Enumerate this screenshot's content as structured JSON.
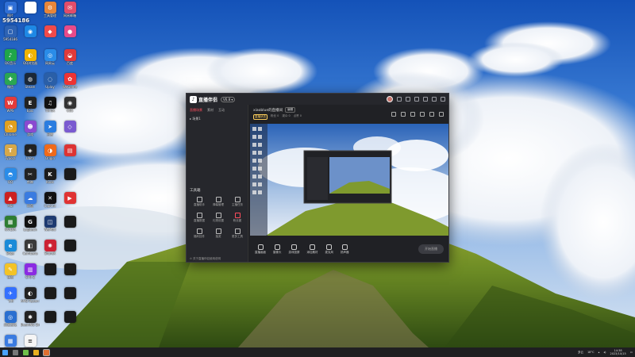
{
  "desktop": {
    "id_label": "5954186",
    "icons": [
      {
        "label": "图片",
        "color": "#2f6fd6",
        "glyph": "▣"
      },
      {
        "label": "",
        "color": "#ffffff",
        "glyph": ""
      },
      {
        "label": "工具管理",
        "color": "#e8863a",
        "glyph": "⚙"
      },
      {
        "label": "网易邮箱",
        "color": "#e14d6a",
        "glyph": "✉"
      },
      {
        "label": "5954186",
        "color": "#2d62b3",
        "glyph": "▢"
      },
      {
        "label": "",
        "color": "#1e88e5",
        "glyph": "◉"
      },
      {
        "label": "",
        "color": "#f04a4a",
        "glyph": "◆"
      },
      {
        "label": "",
        "color": "#e84b8a",
        "glyph": "●"
      },
      {
        "label": "QQ音乐",
        "color": "#1fa64a",
        "glyph": "♪"
      },
      {
        "label": "QQ浏览器",
        "color": "#f0b400",
        "glyph": "◐"
      },
      {
        "label": "网易云",
        "color": "#2a8ce8",
        "glyph": "◎"
      },
      {
        "label": "百度",
        "color": "#e03a3a",
        "glyph": "◒"
      },
      {
        "label": "微信",
        "color": "#2aa652",
        "glyph": "✚"
      },
      {
        "label": "Steam",
        "color": "#1b2838",
        "glyph": "◍"
      },
      {
        "label": "Uplay",
        "color": "#2a5fa8",
        "glyph": "◌"
      },
      {
        "label": "WeGame",
        "color": "#e33",
        "glyph": "✿"
      },
      {
        "label": "WPS",
        "color": "#e33b3b",
        "glyph": "W"
      },
      {
        "label": "Epic",
        "color": "#222",
        "glyph": "E"
      },
      {
        "label": "TikTok",
        "color": "#111",
        "glyph": "♫"
      },
      {
        "label": "OBS",
        "color": "#333",
        "glyph": "◉"
      },
      {
        "label": "Chrome",
        "color": "#e0a020",
        "glyph": "◔"
      },
      {
        "label": "游戏",
        "color": "#8a4ad0",
        "glyph": "☻"
      },
      {
        "label": "迅雷",
        "color": "#2b7de0",
        "glyph": "➤"
      },
      {
        "label": "",
        "color": "#7a5ad0",
        "glyph": "◇"
      },
      {
        "label": "Typora",
        "color": "#d7a84a",
        "glyph": "T"
      },
      {
        "label": "Unity",
        "color": "#222",
        "glyph": "◈"
      },
      {
        "label": "Origin",
        "color": "#f06a1a",
        "glyph": "◑"
      },
      {
        "label": "",
        "color": "#dd3333",
        "glyph": "▤"
      },
      {
        "label": "QQ",
        "color": "#2a8ce8",
        "glyph": "◓"
      },
      {
        "label": "剪映",
        "color": "#222",
        "glyph": "✂"
      },
      {
        "label": "Kook",
        "color": "#1c1c1c",
        "glyph": "K"
      },
      {
        "label": "",
        "color": "#1a1a1a",
        "glyph": ""
      },
      {
        "label": "MSI",
        "color": "#cc2020",
        "glyph": "▲"
      },
      {
        "label": "网盘",
        "color": "#3a7be0",
        "glyph": "☁"
      },
      {
        "label": "CapCut",
        "color": "#111",
        "glyph": "✕"
      },
      {
        "label": "",
        "color": "#e03232",
        "glyph": "▶"
      },
      {
        "label": "NVIDIA",
        "color": "#2e7d32",
        "glyph": "▦"
      },
      {
        "label": "Logitech",
        "color": "#111",
        "glyph": "G"
      },
      {
        "label": "WeMod",
        "color": "#1d3a70",
        "glyph": "◫"
      },
      {
        "label": "",
        "color": "#1a1a1a",
        "glyph": ""
      },
      {
        "label": "Edge",
        "color": "#1a8bd8",
        "glyph": "e"
      },
      {
        "label": "Camtasia",
        "color": "#3a3a3a",
        "glyph": "◧"
      },
      {
        "label": "ShareX",
        "color": "#c23",
        "glyph": "✺"
      },
      {
        "label": "",
        "color": "#1a1a1a",
        "glyph": ""
      },
      {
        "label": "便签",
        "color": "#f3c326",
        "glyph": "✎"
      },
      {
        "label": "CPU-Z",
        "color": "#8a2be2",
        "glyph": "▥"
      },
      {
        "label": "",
        "color": "#1a1a1a",
        "glyph": ""
      },
      {
        "label": "",
        "color": "#1a1a1a",
        "glyph": ""
      },
      {
        "label": "飞书",
        "color": "#3370ff",
        "glyph": "✈"
      },
      {
        "label": "AMD Ryzen Master",
        "color": "#222",
        "glyph": "◐"
      },
      {
        "label": "",
        "color": "#1a1a1a",
        "glyph": ""
      },
      {
        "label": "",
        "color": "#1a1a1a",
        "glyph": ""
      },
      {
        "label": "网易游戏",
        "color": "#2a6fd0",
        "glyph": "◎"
      },
      {
        "label": "BeamNG Drive",
        "color": "#222",
        "glyph": "✱"
      },
      {
        "label": "",
        "color": "#1a1a1a",
        "glyph": ""
      },
      {
        "label": "",
        "color": "#1a1a1a",
        "glyph": ""
      },
      {
        "label": "控制面板",
        "color": "#3a7be0",
        "glyph": "▦"
      },
      {
        "label": "新建文本",
        "color": "#f5f5f5",
        "glyph": "≡"
      }
    ]
  },
  "app": {
    "title": "直播伴侣",
    "version_badge": "V6.8 ▾",
    "left_tabs": [
      "直播场景",
      "素材",
      "互动"
    ],
    "scene_item": "▸  场景1",
    "tools_header": "工具箱",
    "tools": [
      {
        "label": "直播助手"
      },
      {
        "label": "弹幕管理"
      },
      {
        "label": "主播任务"
      },
      {
        "label": "直播数据"
      },
      {
        "label": "礼物设置"
      },
      {
        "label": "粉丝团"
      },
      {
        "label": "福利挂件"
      },
      {
        "label": "抽奖"
      },
      {
        "label": "更多工具"
      }
    ],
    "bottom_note": "⊙ 关于直播伴侣使用说明",
    "room_title": "xiaoblue的直播间",
    "room_button": "编辑",
    "meta_pill": "直播状态",
    "meta_items": [
      "粉丝 0",
      "观众 0",
      "点赞 0"
    ],
    "controls": [
      {
        "label": "直播画面"
      },
      {
        "label": "摄像头"
      },
      {
        "label": "游戏投屏"
      },
      {
        "label": "添加素材"
      },
      {
        "label": "麦克风"
      },
      {
        "label": "扬声器"
      }
    ],
    "go_live": "开始直播"
  },
  "taskbar": {
    "weather": "多云",
    "temp_label": "18°C",
    "time": "14:38",
    "date": "2023/10/15"
  }
}
